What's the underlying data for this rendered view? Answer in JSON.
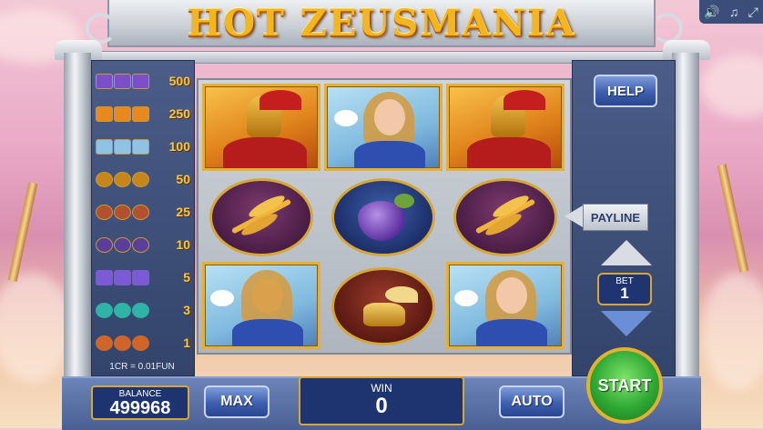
{
  "game": {
    "title": "HOT ZEUSMANIA"
  },
  "window_controls": {
    "sound_icon": "speaker-icon",
    "music_icon": "music-note-icon",
    "fullscreen_icon": "fullscreen-icon"
  },
  "paytable": {
    "rows": [
      {
        "symbol": "zeus",
        "payout": "500"
      },
      {
        "symbol": "warrior",
        "payout": "250"
      },
      {
        "symbol": "goddess",
        "payout": "100"
      },
      {
        "symbol": "laurel",
        "payout": "50"
      },
      {
        "symbol": "sandal",
        "payout": "25"
      },
      {
        "symbol": "grapes",
        "payout": "10"
      },
      {
        "symbol": "lightning",
        "payout": "5"
      },
      {
        "symbol": "gem",
        "payout": "3"
      },
      {
        "symbol": "leaf",
        "payout": "1"
      }
    ],
    "conversion": "1CR = 0.01FUN"
  },
  "reels": [
    [
      "warrior",
      "laurel",
      "goddess"
    ],
    [
      "goddess",
      "grapes",
      "sandal"
    ],
    [
      "warrior",
      "laurel",
      "goddess"
    ]
  ],
  "controls": {
    "help_label": "HELP",
    "payline_label": "PAYLINE",
    "bet_label": "BET",
    "bet_value": "1",
    "max_label": "MAX",
    "auto_label": "AUTO",
    "start_label": "START"
  },
  "status": {
    "balance_label": "BALANCE",
    "balance_value": "499968",
    "win_label": "WIN",
    "win_value": "0"
  },
  "colors": {
    "accent_gold": "#f4b61f",
    "panel_blue": "#33446b",
    "start_green": "#2fa934"
  }
}
